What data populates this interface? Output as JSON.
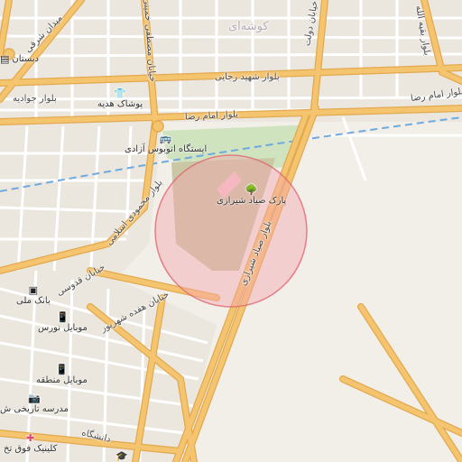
{
  "map": {
    "colors": {
      "background": "#f2efe9",
      "major_road": "#f5c46e",
      "major_road_casing": "#e2a94f",
      "minor_road": "#ffffff",
      "park": "#c9c7a4",
      "green": "#cfe3bf",
      "railway": "#6ea9e0",
      "highlight_fill": "#f4a6ad",
      "highlight_stroke": "#e06870"
    },
    "district_label": "کوشه‌ای",
    "road_labels": {
      "shahid_rajaei": "بلوار شهید رجایی",
      "imam_reza_left": "بلوار امام رضا",
      "imam_reza_right": "بلوار امام رضا",
      "javadieh": "بلوار جوادیه",
      "mahmoudi": "بلوار محمودی اسلامی",
      "sayad_shirazi": "بلوار صیاد شیرازی",
      "mostafa_khomeini": "خیابان مصطفی خمینی",
      "hefdah_shahrivar": "خیابان هفده شهریور",
      "ghodousi": "خیابان قدوسی",
      "baghdad": "بلوار بقیه الله",
      "sharghi": "میدان شرقی",
      "daneshgah": "دانشگاه",
      "dolat": "خیابان دولت"
    },
    "pois": [
      {
        "icon": "▤",
        "name": "دبستان",
        "icon_name": "school-icon"
      },
      {
        "icon": "👕",
        "name": "پوشاک هدیه",
        "icon_name": "clothing-store-icon"
      },
      {
        "icon": "🚌",
        "name": "ایستگاه اتوبوس آزادی",
        "icon_name": "bus-icon"
      },
      {
        "icon": "🌳",
        "name": "پارک صیاد شیرازی",
        "icon_name": "park-icon"
      },
      {
        "icon": "▣",
        "name": "بانک ملی",
        "icon_name": "bank-icon"
      },
      {
        "icon": "📱",
        "name": "موبایل نورس",
        "icon_name": "phone-shop-icon"
      },
      {
        "icon": "📱",
        "name": "موبایل منطقه",
        "icon_name": "phone-shop-icon"
      },
      {
        "icon": "📷",
        "name": "مدرسه تاریخی ش",
        "icon_name": "camera-icon"
      },
      {
        "icon": "✚",
        "name": "کلینیک فوق تخ",
        "icon_name": "clinic-icon"
      },
      {
        "icon": "🎓",
        "name": "",
        "icon_name": "university-icon"
      }
    ]
  }
}
